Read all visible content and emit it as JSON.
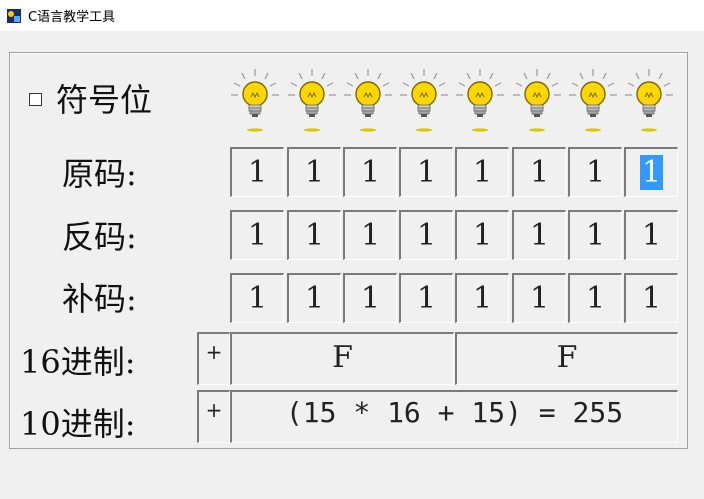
{
  "window": {
    "title": "C语言教学工具",
    "app_icon": "app-icon"
  },
  "sign_bit": {
    "label": "符号位",
    "checked": false
  },
  "bulbs": [
    true,
    true,
    true,
    true,
    true,
    true,
    true,
    true
  ],
  "rows": [
    {
      "label": "原码:",
      "bits": [
        "1",
        "1",
        "1",
        "1",
        "1",
        "1",
        "1",
        "1"
      ]
    },
    {
      "label": "反码:",
      "bits": [
        "1",
        "1",
        "1",
        "1",
        "1",
        "1",
        "1",
        "1"
      ]
    },
    {
      "label": "补码:",
      "bits": [
        "1",
        "1",
        "1",
        "1",
        "1",
        "1",
        "1",
        "1"
      ]
    }
  ],
  "selected_bit": {
    "row": 0,
    "index": 7
  },
  "hex": {
    "label": "16进制:",
    "sign": "+",
    "high": "F",
    "low": "F"
  },
  "dec": {
    "label": "10进制:",
    "sign": "+",
    "formula": "(15 * 16 + 15) = 255"
  },
  "colors": {
    "bulb_yellow": "#ffd700",
    "selection": "#3399ff"
  }
}
